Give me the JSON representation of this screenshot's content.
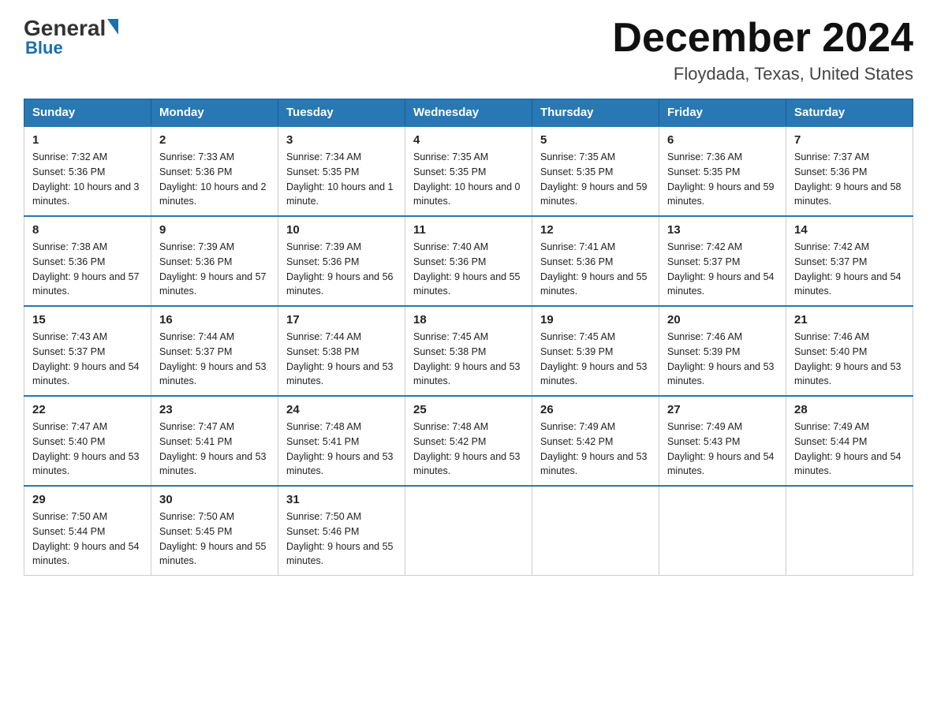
{
  "logo": {
    "general": "General",
    "blue": "Blue",
    "subtitle": "Blue"
  },
  "header": {
    "month": "December 2024",
    "location": "Floydada, Texas, United States"
  },
  "days_of_week": [
    "Sunday",
    "Monday",
    "Tuesday",
    "Wednesday",
    "Thursday",
    "Friday",
    "Saturday"
  ],
  "weeks": [
    [
      {
        "num": "1",
        "sunrise": "7:32 AM",
        "sunset": "5:36 PM",
        "daylight": "10 hours and 3 minutes."
      },
      {
        "num": "2",
        "sunrise": "7:33 AM",
        "sunset": "5:36 PM",
        "daylight": "10 hours and 2 minutes."
      },
      {
        "num": "3",
        "sunrise": "7:34 AM",
        "sunset": "5:35 PM",
        "daylight": "10 hours and 1 minute."
      },
      {
        "num": "4",
        "sunrise": "7:35 AM",
        "sunset": "5:35 PM",
        "daylight": "10 hours and 0 minutes."
      },
      {
        "num": "5",
        "sunrise": "7:35 AM",
        "sunset": "5:35 PM",
        "daylight": "9 hours and 59 minutes."
      },
      {
        "num": "6",
        "sunrise": "7:36 AM",
        "sunset": "5:35 PM",
        "daylight": "9 hours and 59 minutes."
      },
      {
        "num": "7",
        "sunrise": "7:37 AM",
        "sunset": "5:36 PM",
        "daylight": "9 hours and 58 minutes."
      }
    ],
    [
      {
        "num": "8",
        "sunrise": "7:38 AM",
        "sunset": "5:36 PM",
        "daylight": "9 hours and 57 minutes."
      },
      {
        "num": "9",
        "sunrise": "7:39 AM",
        "sunset": "5:36 PM",
        "daylight": "9 hours and 57 minutes."
      },
      {
        "num": "10",
        "sunrise": "7:39 AM",
        "sunset": "5:36 PM",
        "daylight": "9 hours and 56 minutes."
      },
      {
        "num": "11",
        "sunrise": "7:40 AM",
        "sunset": "5:36 PM",
        "daylight": "9 hours and 55 minutes."
      },
      {
        "num": "12",
        "sunrise": "7:41 AM",
        "sunset": "5:36 PM",
        "daylight": "9 hours and 55 minutes."
      },
      {
        "num": "13",
        "sunrise": "7:42 AM",
        "sunset": "5:37 PM",
        "daylight": "9 hours and 54 minutes."
      },
      {
        "num": "14",
        "sunrise": "7:42 AM",
        "sunset": "5:37 PM",
        "daylight": "9 hours and 54 minutes."
      }
    ],
    [
      {
        "num": "15",
        "sunrise": "7:43 AM",
        "sunset": "5:37 PM",
        "daylight": "9 hours and 54 minutes."
      },
      {
        "num": "16",
        "sunrise": "7:44 AM",
        "sunset": "5:37 PM",
        "daylight": "9 hours and 53 minutes."
      },
      {
        "num": "17",
        "sunrise": "7:44 AM",
        "sunset": "5:38 PM",
        "daylight": "9 hours and 53 minutes."
      },
      {
        "num": "18",
        "sunrise": "7:45 AM",
        "sunset": "5:38 PM",
        "daylight": "9 hours and 53 minutes."
      },
      {
        "num": "19",
        "sunrise": "7:45 AM",
        "sunset": "5:39 PM",
        "daylight": "9 hours and 53 minutes."
      },
      {
        "num": "20",
        "sunrise": "7:46 AM",
        "sunset": "5:39 PM",
        "daylight": "9 hours and 53 minutes."
      },
      {
        "num": "21",
        "sunrise": "7:46 AM",
        "sunset": "5:40 PM",
        "daylight": "9 hours and 53 minutes."
      }
    ],
    [
      {
        "num": "22",
        "sunrise": "7:47 AM",
        "sunset": "5:40 PM",
        "daylight": "9 hours and 53 minutes."
      },
      {
        "num": "23",
        "sunrise": "7:47 AM",
        "sunset": "5:41 PM",
        "daylight": "9 hours and 53 minutes."
      },
      {
        "num": "24",
        "sunrise": "7:48 AM",
        "sunset": "5:41 PM",
        "daylight": "9 hours and 53 minutes."
      },
      {
        "num": "25",
        "sunrise": "7:48 AM",
        "sunset": "5:42 PM",
        "daylight": "9 hours and 53 minutes."
      },
      {
        "num": "26",
        "sunrise": "7:49 AM",
        "sunset": "5:42 PM",
        "daylight": "9 hours and 53 minutes."
      },
      {
        "num": "27",
        "sunrise": "7:49 AM",
        "sunset": "5:43 PM",
        "daylight": "9 hours and 54 minutes."
      },
      {
        "num": "28",
        "sunrise": "7:49 AM",
        "sunset": "5:44 PM",
        "daylight": "9 hours and 54 minutes."
      }
    ],
    [
      {
        "num": "29",
        "sunrise": "7:50 AM",
        "sunset": "5:44 PM",
        "daylight": "9 hours and 54 minutes."
      },
      {
        "num": "30",
        "sunrise": "7:50 AM",
        "sunset": "5:45 PM",
        "daylight": "9 hours and 55 minutes."
      },
      {
        "num": "31",
        "sunrise": "7:50 AM",
        "sunset": "5:46 PM",
        "daylight": "9 hours and 55 minutes."
      },
      null,
      null,
      null,
      null
    ]
  ]
}
